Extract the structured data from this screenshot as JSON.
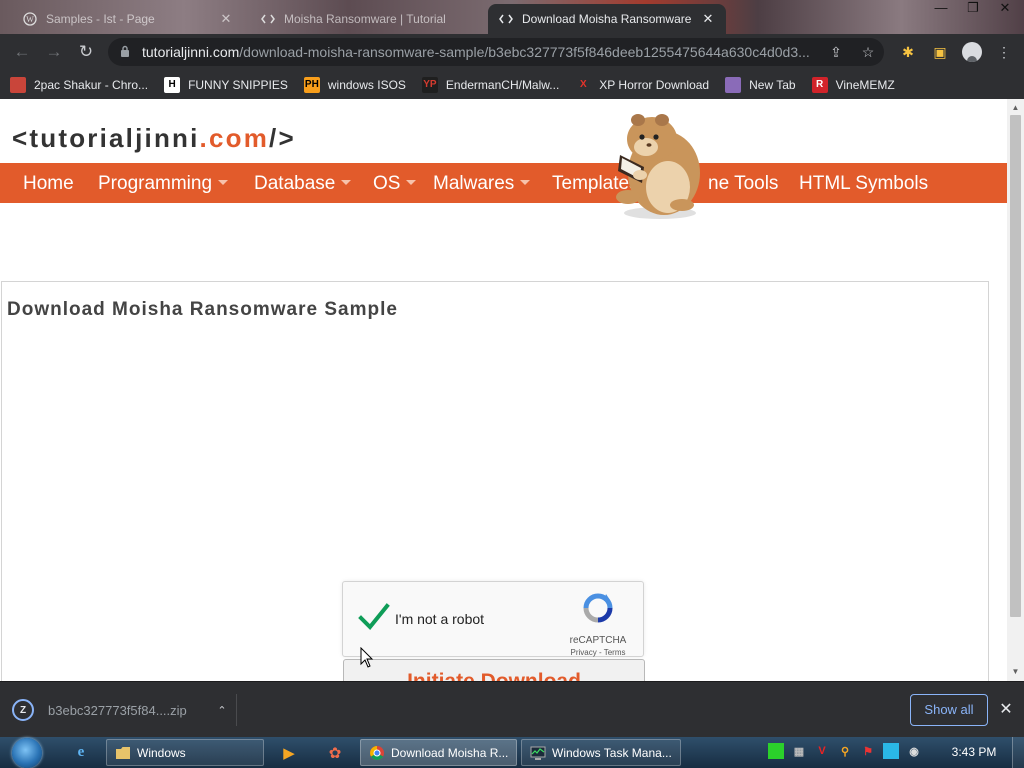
{
  "tabs": [
    {
      "title": "Samples - Ist - Page",
      "icon": "wordpress-icon",
      "close": "✕"
    },
    {
      "title": "Moisha Ransomware | Tutorial",
      "icon": "code-icon",
      "close": "✕"
    },
    {
      "title": "Download Moisha Ransomware",
      "icon": "code-icon",
      "close": "✕"
    }
  ],
  "window_controls": {
    "minimize": "—",
    "restore": "❐",
    "close": "✕"
  },
  "toolbar": {
    "back": "←",
    "forward": "→",
    "reload": "↻",
    "url_host": "tutorialjinni.com",
    "url_path": "/download-moisha-ransomware-sample/b3ebc327773f5f846deeb1255475644a630c4d0d3...",
    "share": "⇪",
    "bookmark_star": "☆",
    "extensions": "✱",
    "side_panel": "▣",
    "menu": "⋮"
  },
  "bookmarks": [
    {
      "label": "2pac Shakur - Chro...",
      "icon": "bag-icon",
      "glyph": ""
    },
    {
      "label": "FUNNY SNIPPIES",
      "icon": "h-icon",
      "glyph": "H"
    },
    {
      "label": "windows ISOS",
      "icon": "ph-icon",
      "glyph": "PH"
    },
    {
      "label": "EndermanCH/Malw...",
      "icon": "yp-icon",
      "glyph": "YP"
    },
    {
      "label": "XP Horror Download",
      "icon": "x-icon",
      "glyph": "X"
    },
    {
      "label": "New Tab",
      "icon": "globe-icon",
      "glyph": ""
    },
    {
      "label": "VineMEMZ",
      "icon": "r-icon",
      "glyph": "R"
    }
  ],
  "site": {
    "logo_prefix": "<",
    "logo_name": "tutorialjinni",
    "logo_tld": ".com",
    "logo_suffix": "/>",
    "accent": "#e25b2b",
    "nav": [
      {
        "label": "Home",
        "has_caret": false
      },
      {
        "label": "Programming",
        "has_caret": true
      },
      {
        "label": "Database",
        "has_caret": true
      },
      {
        "label": "OS",
        "has_caret": true
      },
      {
        "label": "Malwares",
        "has_caret": true
      },
      {
        "label": "Templates",
        "has_caret": false
      },
      {
        "label": "ne Tools",
        "has_caret": false
      },
      {
        "label": "HTML Symbols",
        "has_caret": false
      }
    ]
  },
  "page": {
    "heading": "Download Moisha Ransomware Sample",
    "captcha": {
      "label": "I'm not a robot",
      "checked": true,
      "brand": "reCAPTCHA",
      "links": "Privacy - Terms"
    },
    "download_button": "Initiate Download"
  },
  "download_shelf": {
    "file_name": "b3ebc327773f5f84....zip",
    "file_icon": "Z",
    "chevron": "⌃",
    "show_all": "Show all",
    "close": "✕"
  },
  "taskbar": {
    "pinned": [
      {
        "name": "ie-icon",
        "glyph": "e"
      },
      {
        "name": "media-player-icon",
        "glyph": "▶"
      },
      {
        "name": "paint-icon",
        "glyph": "✿"
      }
    ],
    "apps": [
      {
        "label": "Windows",
        "icon": "folder-icon",
        "active": false
      },
      {
        "label": "Download Moisha R...",
        "icon": "chrome-icon",
        "active": true
      },
      {
        "label": "Windows Task Mana...",
        "icon": "task-manager-icon",
        "active": false
      }
    ],
    "clock": "3:43 PM"
  }
}
